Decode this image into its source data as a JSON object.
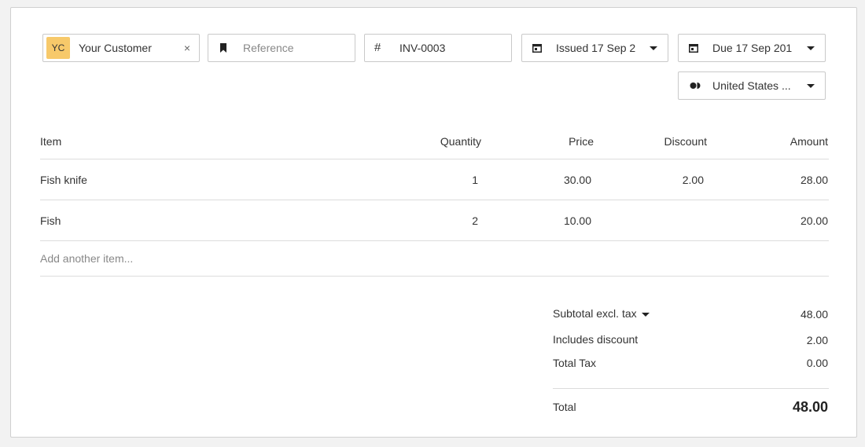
{
  "contact": {
    "initials": "YC",
    "name": "Your Customer",
    "clear": "×"
  },
  "reference": {
    "placeholder": "Reference"
  },
  "invoice_number": {
    "symbol": "#",
    "value": "INV-0003"
  },
  "issued": {
    "label": "Issued 17 Sep 2"
  },
  "due": {
    "label": "Due 17 Sep 201"
  },
  "currency": {
    "label": "United States ..."
  },
  "table": {
    "headers": {
      "item": "Item",
      "quantity": "Quantity",
      "price": "Price",
      "discount": "Discount",
      "amount": "Amount"
    },
    "rows": [
      {
        "item": "Fish knife",
        "quantity": "1",
        "price": "30.00",
        "discount": "2.00",
        "amount": "28.00"
      },
      {
        "item": "Fish",
        "quantity": "2",
        "price": "10.00",
        "discount": "",
        "amount": "20.00"
      }
    ],
    "add_item": "Add another item..."
  },
  "summary": {
    "subtotal_label": "Subtotal excl. tax",
    "subtotal": "48.00",
    "discount_label": "Includes discount",
    "discount": "2.00",
    "tax_label": "Total Tax",
    "tax": "0.00",
    "total_label": "Total",
    "total": "48.00"
  }
}
